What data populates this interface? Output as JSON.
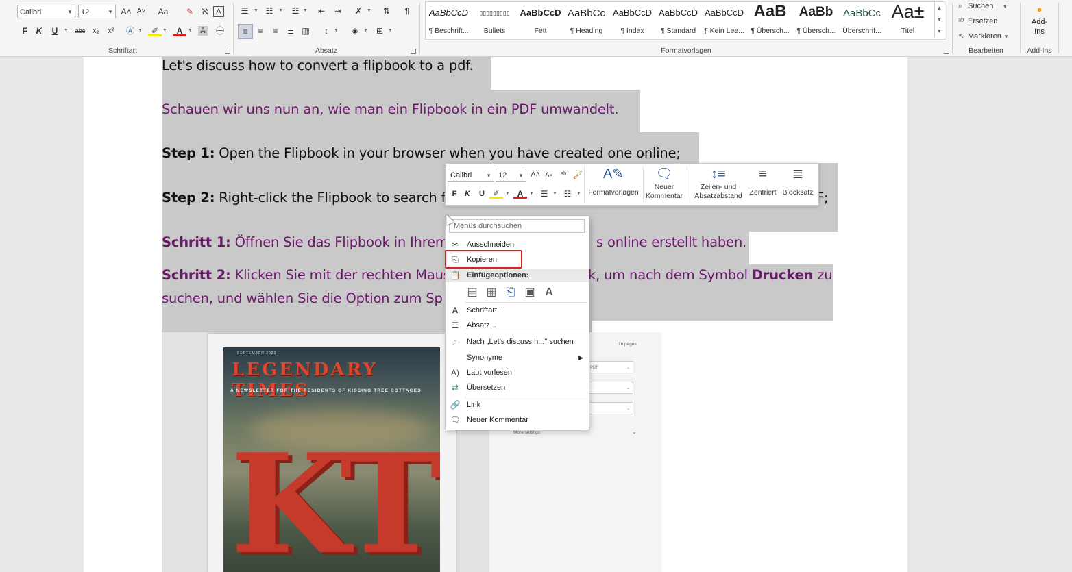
{
  "ribbon": {
    "font_name": "Calibri",
    "font_size": "12",
    "font_size_mini": "12",
    "groups": {
      "schriftart": "Schriftart",
      "absatz": "Absatz",
      "formatvorlagen": "Formatvorlagen",
      "bearbeiten": "Bearbeiten",
      "addins": "Add-Ins"
    },
    "format_buttons": {
      "bold": "F",
      "italic": "K",
      "underline": "U",
      "strike": "abc",
      "sub": "x₂",
      "sup": "x²",
      "grow": "A˄",
      "shrink": "A˅",
      "case": "Aa",
      "pilcrow": "¶"
    },
    "styles": [
      {
        "sample": "AaBbCcD",
        "name": "¶ Beschrift..."
      },
      {
        "sample": "▯▯▯▯▯▯▯▯▯",
        "name": "Bullets"
      },
      {
        "sample": "AaBbCcD",
        "name": "Fett"
      },
      {
        "sample": "AaBbCc",
        "name": "¶ Heading"
      },
      {
        "sample": "AaBbCcD",
        "name": "¶ Index"
      },
      {
        "sample": "AaBbCcD",
        "name": "¶ Standard"
      },
      {
        "sample": "AaBbCcD",
        "name": "¶ Kein Lee..."
      },
      {
        "sample": "AaB",
        "name": "¶ Übersch..."
      },
      {
        "sample": "AaBb",
        "name": "¶ Übersch..."
      },
      {
        "sample": "AaBbCc",
        "name": "Überschrif..."
      },
      {
        "sample": "Aa±",
        "name": "Titel"
      }
    ],
    "edit": {
      "search": "Suchen",
      "replace": "Ersetzen",
      "select": "Markieren"
    },
    "addins_label": "Add-Ins"
  },
  "document": {
    "line1": "Let's discuss how to convert a flipbook to a pdf.",
    "line2": "Schauen wir uns nun an, wie man ein Flipbook in ein PDF umwandelt.",
    "step1_label": "Step 1:",
    "step1_text": " Open the Flipbook in your browser when you have created one online;",
    "step2_label": "Step 2:",
    "step2_text_a": " Right-click the Flipbook to search f",
    "step2_text_b": "F;",
    "schritt1_label": "Schritt 1:",
    "schritt1_text_a": " Öffnen Sie das Flipbook in Ihrem",
    "schritt1_text_b": "s online erstellt haben.",
    "schritt2_label": "Schritt 2:",
    "schritt2_text_a": " Klicken Sie mit der rechten Maus",
    "schritt2_text_b": "k, um nach dem Symbol ",
    "schritt2_bold": "Drucken",
    "schritt2_text_c": " zu",
    "schritt2_line2": "suchen, und wählen Sie die Option zum Sp"
  },
  "embedded_image": {
    "month": "SEPTEMBER 2023",
    "masthead": "LEGENDARY TIMES",
    "subtitle": "A NEWSLETTER FOR THE RESIDENTS OF KISSING TREE COTTAGES",
    "letters": "KT",
    "pages": "16 pages",
    "dest": "ve as PDF",
    "more": "More settings"
  },
  "mini_toolbar": {
    "formatvorlagen": "Formatvorlagen",
    "neuer_kommentar": "Neuer Kommentar",
    "zeilen": "Zeilen- und Absatzabstand",
    "zentriert": "Zentriert",
    "blocksatz": "Blocksatz"
  },
  "context_menu": {
    "search_placeholder": "Menüs durchsuchen",
    "items": {
      "ausschneiden": "Ausschneiden",
      "kopieren": "Kopieren",
      "einfuegeoptionen": "Einfügeoptionen:",
      "schriftart": "Schriftart...",
      "absatz": "Absatz...",
      "nach_suchen": "Nach „Let's discuss h...\" suchen",
      "synonyme": "Synonyme",
      "laut_vorlesen": "Laut vorlesen",
      "uebersetzen": "Übersetzen",
      "link": "Link",
      "neuer_kommentar": "Neuer Kommentar"
    }
  },
  "colors": {
    "german_text": "#6a1a6a",
    "selection": "#c9c9c9",
    "highlight_border": "#e02020"
  }
}
